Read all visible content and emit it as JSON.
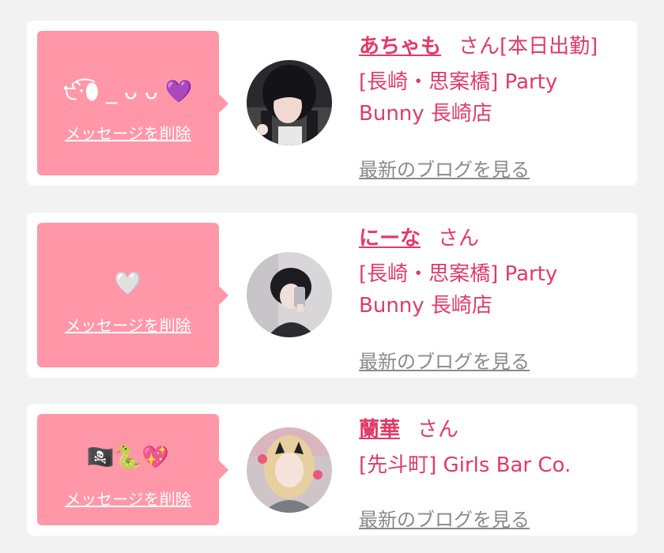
{
  "cards": [
    {
      "message": "੯‧̀͡⬮ _ ᴗ ᴗ 💜",
      "delete_label": "メッセージを削除",
      "name": "あちゃも",
      "san": "さん",
      "status": "[本日出勤]",
      "shop": "[長崎・思案橋] Party Bunny 長崎店",
      "blog_label": "最新のブログを見る"
    },
    {
      "message": "🤍",
      "delete_label": "メッセージを削除",
      "name": "にーな",
      "san": "さん",
      "status": "",
      "shop": "[長崎・思案橋] Party Bunny 長崎店",
      "blog_label": "最新のブログを見る"
    },
    {
      "message": "🏴‍☠️🐍💖",
      "delete_label": "メッセージを削除",
      "name": "蘭華",
      "san": "さん",
      "status": "",
      "shop": "[先斗町] Girls Bar Co.",
      "blog_label": "最新のブログを見る"
    }
  ],
  "colors": {
    "accent": "#e23a66",
    "bubble": "#ff97a8",
    "link_gray": "#8a8a8a",
    "background": "#f2f2f3"
  }
}
